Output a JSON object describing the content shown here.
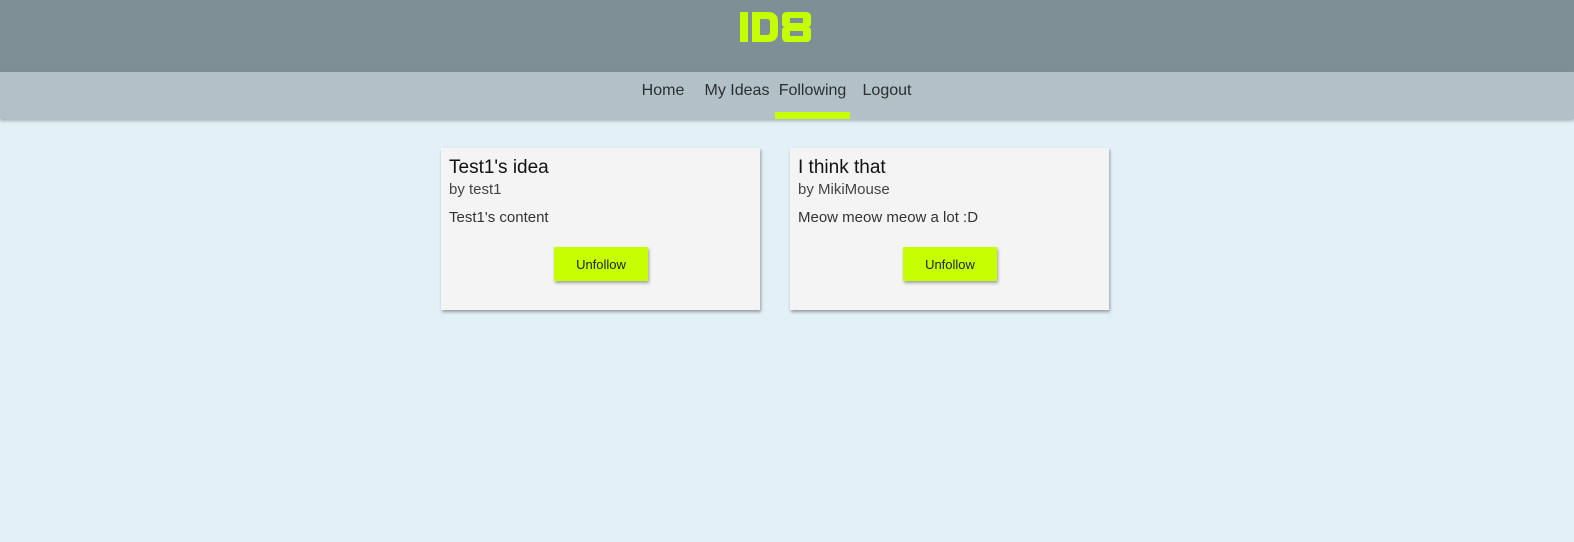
{
  "app": {
    "logo_text": "ID8",
    "accent_color": "#c6ff00"
  },
  "nav": {
    "items": [
      {
        "label": "Home"
      },
      {
        "label": "My Ideas"
      },
      {
        "label": "Following",
        "active": true
      },
      {
        "label": "Logout"
      }
    ]
  },
  "cards": [
    {
      "title": "Test1's idea",
      "author": "by test1",
      "content": "Test1's content",
      "button_label": "Unfollow"
    },
    {
      "title": "I think that",
      "author": "by MikiMouse",
      "content": "Meow meow meow a lot :D",
      "button_label": "Unfollow"
    }
  ]
}
